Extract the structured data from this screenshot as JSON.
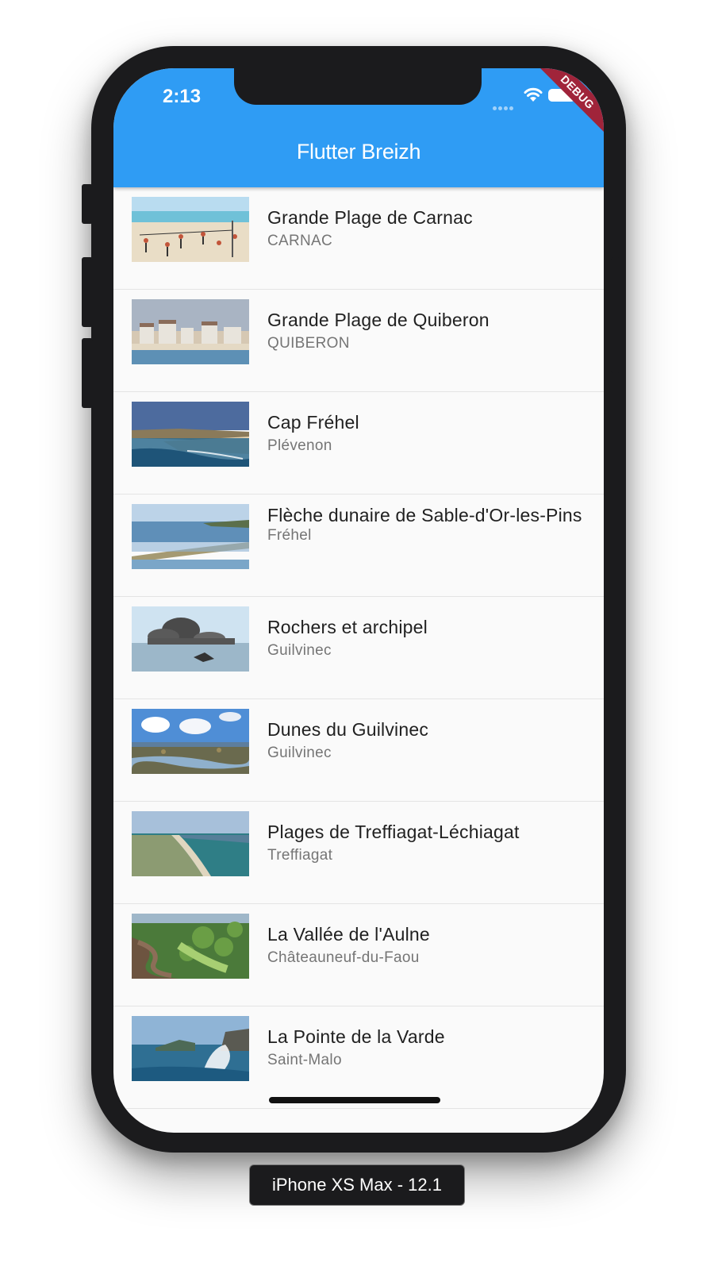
{
  "status_bar": {
    "time": "2:13"
  },
  "app_bar": {
    "title": "Flutter Breizh",
    "debug_banner": "DEBUG",
    "color": "#2f9cf4"
  },
  "places": [
    {
      "title": "Grande Plage de Carnac",
      "subtitle": "CARNAC",
      "scene": "beach-crowd"
    },
    {
      "title": "Grande Plage de Quiberon",
      "subtitle": "QUIBERON",
      "scene": "seafront-town"
    },
    {
      "title": "Cap Fréhel",
      "subtitle": "Plévenon",
      "scene": "coast-cliff"
    },
    {
      "title": "Flèche dunaire de Sable-d'Or-les-Pins",
      "subtitle": "Fréhel",
      "scene": "lagoon"
    },
    {
      "title": "Rochers et archipel",
      "subtitle": "Guilvinec",
      "scene": "rocks"
    },
    {
      "title": "Dunes du Guilvinec",
      "subtitle": "Guilvinec",
      "scene": "tidal-flats"
    },
    {
      "title": "Plages de Treffiagat-Léchiagat",
      "subtitle": "Treffiagat",
      "scene": "dune-beach"
    },
    {
      "title": "La Vallée de l'Aulne",
      "subtitle": "Châteauneuf-du-Faou",
      "scene": "river-valley"
    },
    {
      "title": "La Pointe de la Varde",
      "subtitle": "Saint-Malo",
      "scene": "wave-cliff"
    }
  ],
  "device_label": "iPhone XS Max - 12.1"
}
